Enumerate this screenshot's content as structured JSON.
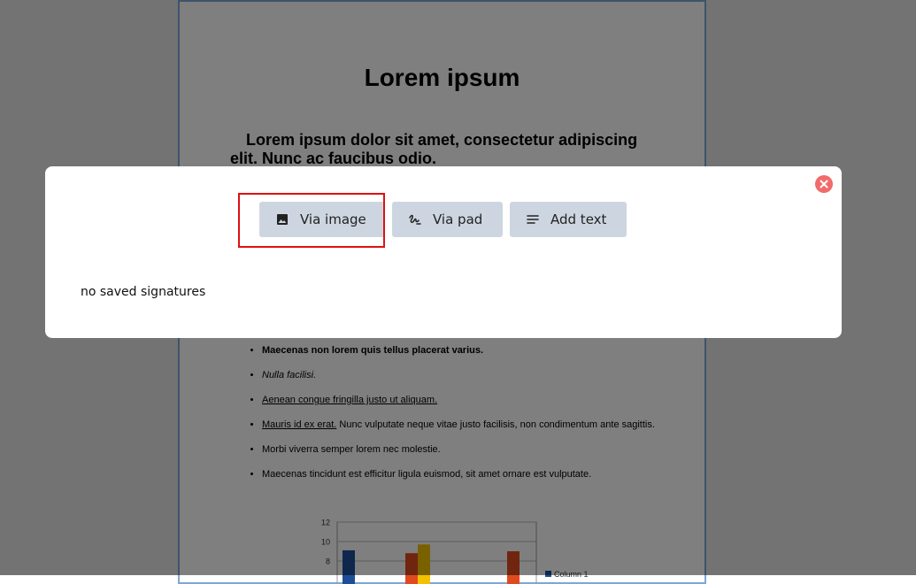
{
  "document": {
    "title": "Lorem ipsum",
    "lead": "Lorem ipsum dolor sit amet, consectetur adipiscing elit. Nunc ac faucibus odio.",
    "list_items": {
      "item1": "Maecenas non lorem quis tellus placerat varius.",
      "item2": "Nulla facilisi.",
      "item3": "Aenean congue fringilla justo ut aliquam.",
      "item4_link": "Mauris id ex erat.",
      "item4_rest": " Nunc vulputate neque vitae justo facilisis, non condimentum ante sagittis.",
      "item5": "Morbi viverra semper lorem nec molestie.",
      "item6": "Maecenas tincidunt est efficitur ligula euismod, sit amet ornare est vulputate."
    }
  },
  "chart_data": {
    "type": "bar",
    "y_ticks": [
      "12",
      "10",
      "8"
    ],
    "ylim": [
      0,
      12
    ],
    "grid": true,
    "legend_position": "right",
    "series": [
      {
        "name": "Column 1",
        "color": "#1f4e99",
        "values": [
          9.1,
          null,
          null
        ]
      },
      {
        "color": "#e04a1f",
        "values": [
          null,
          8.8,
          9.0
        ]
      },
      {
        "color": "#f2c200",
        "values": [
          null,
          9.7,
          null
        ]
      }
    ]
  },
  "modal": {
    "buttons": {
      "via_image": "Via image",
      "via_pad": "Via pad",
      "add_text": "Add text"
    },
    "icons": {
      "via_image": "image-icon",
      "via_pad": "signature-icon",
      "add_text": "text-lines-icon",
      "close": "close-icon"
    },
    "empty_message": "no saved signatures"
  },
  "colors": {
    "overlay": "rgba(0,0,0,0.5)",
    "button_bg": "#cdd6e0",
    "close_bg": "#f16b6b",
    "highlight": "#e01010"
  }
}
